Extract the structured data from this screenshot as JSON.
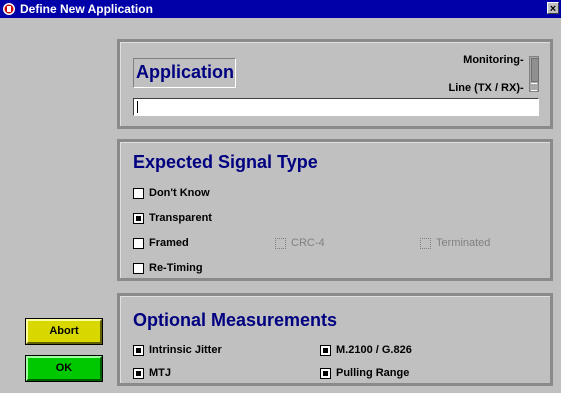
{
  "window": {
    "title": "Define New Application",
    "close_glyph": "×"
  },
  "application": {
    "heading": "Application",
    "monitoring_label": "Monitoring",
    "line_label": "Line (TX / RX)",
    "name_value": ""
  },
  "signal_type": {
    "heading": "Expected Signal Type",
    "options": [
      {
        "label": "Don't Know",
        "checked": false
      },
      {
        "label": "Transparent",
        "checked": true
      },
      {
        "label": "Framed",
        "checked": false
      },
      {
        "label": "Re-Timing",
        "checked": false
      }
    ],
    "crc4": {
      "label": "CRC-4",
      "enabled": false
    },
    "terminated": {
      "label": "Terminated",
      "enabled": false
    }
  },
  "optional": {
    "heading": "Optional Measurements",
    "items": [
      {
        "label": "Intrinsic Jitter",
        "checked": true
      },
      {
        "label": "M.2100 / G.826",
        "checked": true
      },
      {
        "label": "MTJ",
        "checked": true
      },
      {
        "label": "Pulling Range",
        "checked": true
      }
    ]
  },
  "buttons": {
    "abort": "Abort",
    "ok": "OK"
  },
  "colors": {
    "titlebar": "#0000a8",
    "heading": "#000080",
    "abort": "#d8d800",
    "ok": "#00c800",
    "background": "#c0c0c0"
  }
}
